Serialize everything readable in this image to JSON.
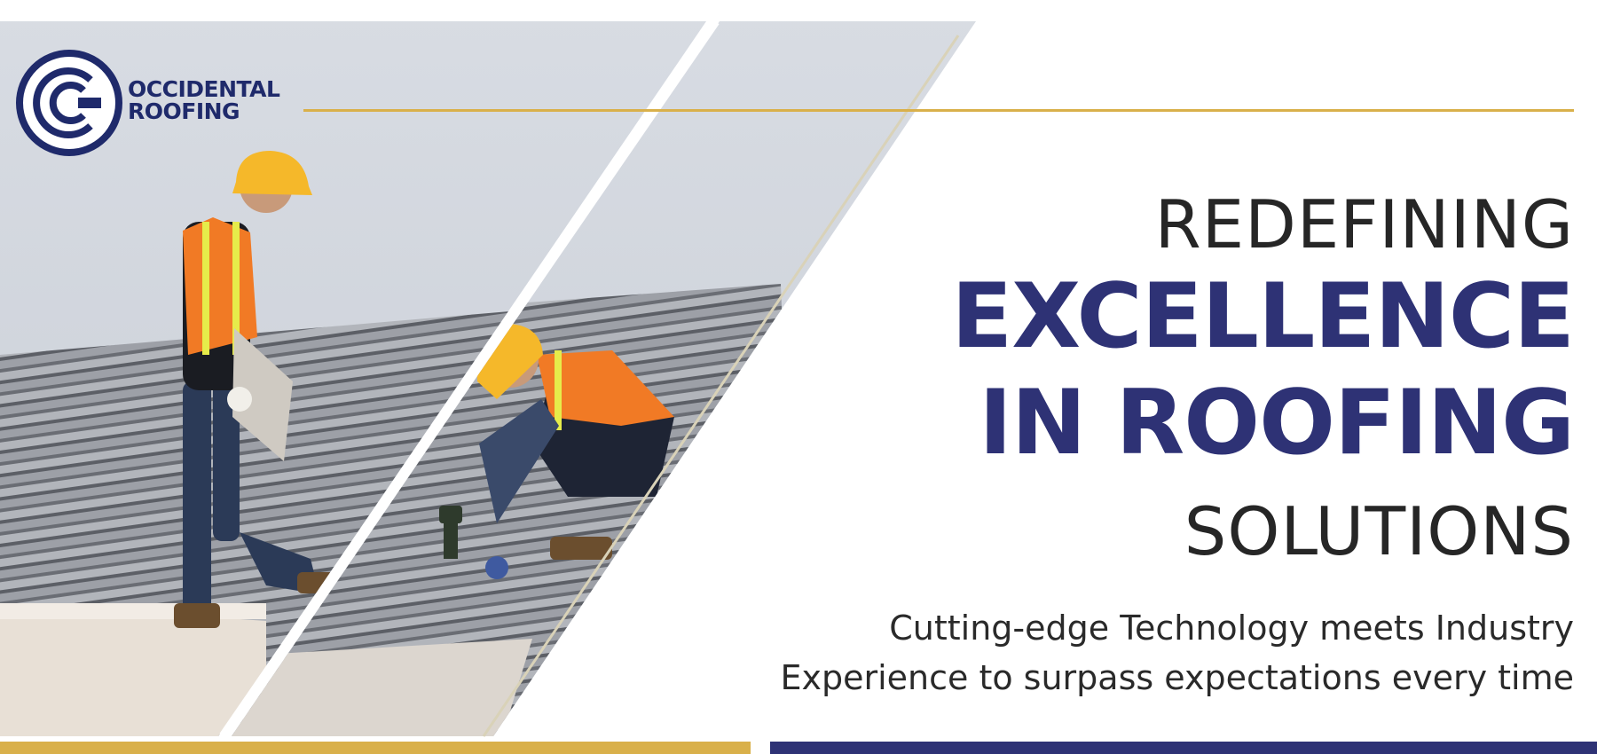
{
  "brand": {
    "name_line1": "OCCIDENTAL",
    "name_line2": "ROOFING",
    "logo_icon": "oc-monogram-icon"
  },
  "hero": {
    "headline": [
      "REDEFINING",
      "EXCELLENCE",
      "IN ROOFING",
      "SOLUTIONS"
    ],
    "tagline": [
      "Cutting-edge Technology meets Industry",
      "Experience to surpass expectations every time"
    ],
    "photo_subject": "roofers-on-tile-roof-image"
  },
  "colors": {
    "navy": "#2e3275",
    "gold": "#d9b04a",
    "text_dark": "#262626",
    "background": "#ffffff"
  }
}
